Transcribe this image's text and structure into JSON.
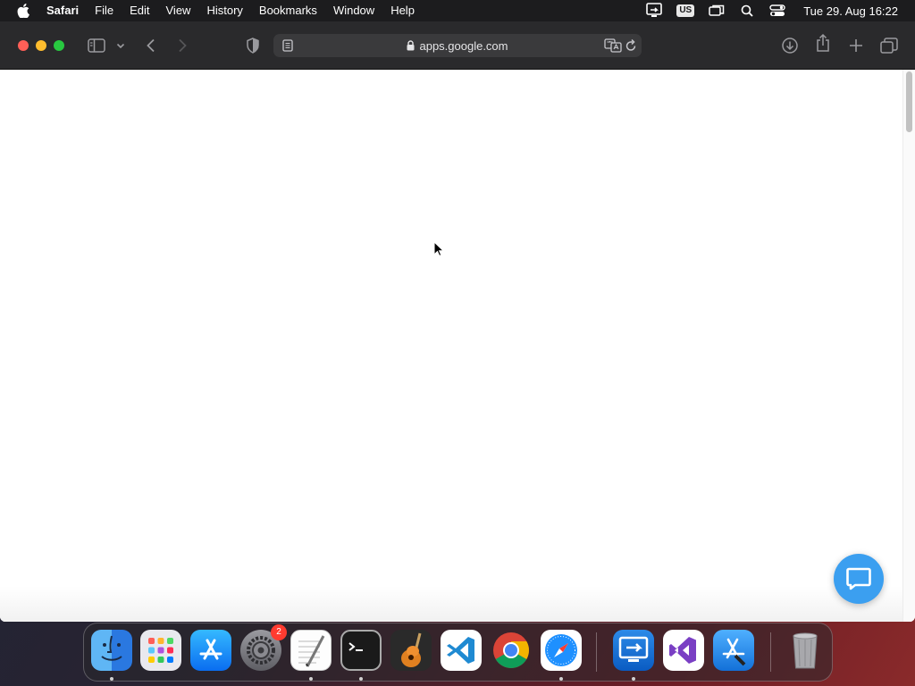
{
  "menubar": {
    "app_name": "Safari",
    "items": [
      "File",
      "Edit",
      "View",
      "History",
      "Bookmarks",
      "Window",
      "Help"
    ],
    "keyboard_layout": "US",
    "clock": "Tue 29. Aug  16:22"
  },
  "browser": {
    "url": "apps.google.com",
    "secure": true
  },
  "page": {
    "chat_button_color": "#3b9ff0"
  },
  "dock": {
    "apps": [
      {
        "name": "Finder",
        "running": true
      },
      {
        "name": "Launchpad",
        "running": false
      },
      {
        "name": "App Store",
        "running": false
      },
      {
        "name": "System Settings",
        "running": false,
        "badge": "2"
      },
      {
        "name": "TextEdit",
        "running": true
      },
      {
        "name": "Terminal",
        "running": true
      },
      {
        "name": "GarageBand",
        "running": false
      },
      {
        "name": "Visual Studio Code",
        "running": false
      },
      {
        "name": "Google Chrome",
        "running": false
      },
      {
        "name": "Safari",
        "running": true
      },
      {
        "name": "Microsoft Remote Desktop",
        "running": true
      },
      {
        "name": "Visual Studio",
        "running": false
      },
      {
        "name": "Xcode",
        "running": false
      },
      {
        "name": "Trash",
        "running": false
      }
    ]
  }
}
